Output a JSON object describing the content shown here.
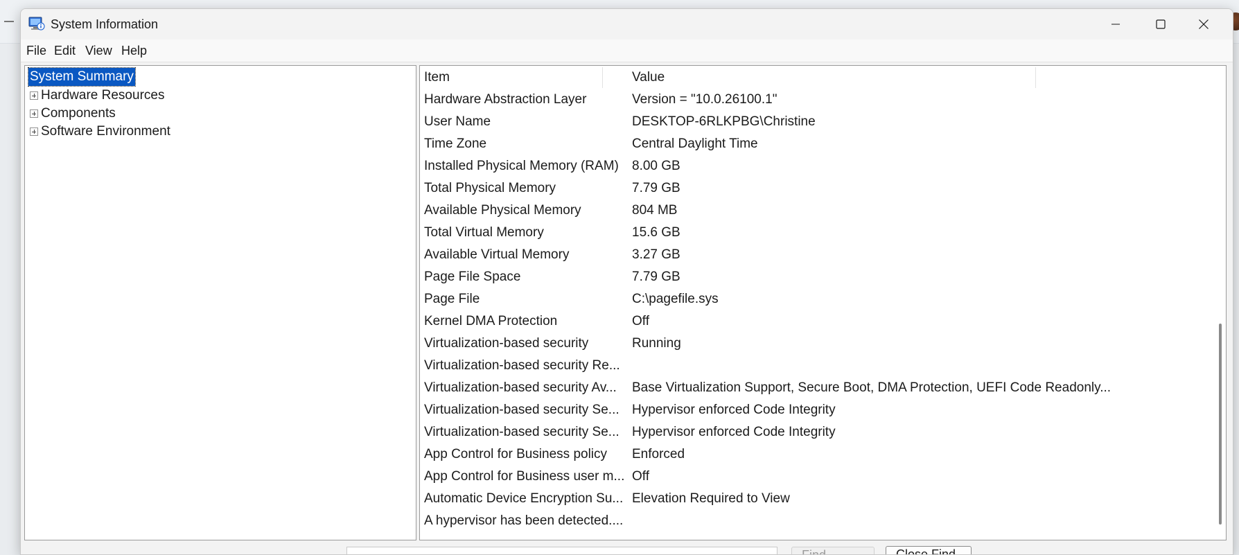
{
  "window": {
    "title": "System Information"
  },
  "menu": [
    "File",
    "Edit",
    "View",
    "Help"
  ],
  "tree": {
    "selected": "System Summary",
    "children": [
      "Hardware Resources",
      "Components",
      "Software Environment"
    ]
  },
  "list": {
    "columns": [
      "Item",
      "Value"
    ],
    "rows": [
      {
        "item": "Hardware Abstraction Layer",
        "value": "Version = \"10.0.26100.1\""
      },
      {
        "item": "User Name",
        "value": "DESKTOP-6RLKPBG\\Christine"
      },
      {
        "item": "Time Zone",
        "value": "Central Daylight Time"
      },
      {
        "item": "Installed Physical Memory (RAM)",
        "value": "8.00 GB"
      },
      {
        "item": "Total Physical Memory",
        "value": "7.79 GB"
      },
      {
        "item": "Available Physical Memory",
        "value": "804 MB"
      },
      {
        "item": "Total Virtual Memory",
        "value": "15.6 GB"
      },
      {
        "item": "Available Virtual Memory",
        "value": "3.27 GB"
      },
      {
        "item": "Page File Space",
        "value": "7.79 GB"
      },
      {
        "item": "Page File",
        "value": "C:\\pagefile.sys"
      },
      {
        "item": "Kernel DMA Protection",
        "value": "Off"
      },
      {
        "item": "Virtualization-based security",
        "value": "Running"
      },
      {
        "item": "Virtualization-based security Re...",
        "value": ""
      },
      {
        "item": "Virtualization-based security Av...",
        "value": "Base Virtualization Support, Secure Boot, DMA Protection, UEFI Code Readonly..."
      },
      {
        "item": "Virtualization-based security Se...",
        "value": "Hypervisor enforced Code Integrity"
      },
      {
        "item": "Virtualization-based security Se...",
        "value": "Hypervisor enforced Code Integrity"
      },
      {
        "item": "App Control for Business policy",
        "value": "Enforced"
      },
      {
        "item": "App Control for Business user m...",
        "value": "Off"
      },
      {
        "item": "Automatic Device Encryption Su...",
        "value": "Elevation Required to View"
      },
      {
        "item": "A hypervisor has been detected....",
        "value": ""
      }
    ]
  },
  "find": {
    "find_label": "Find",
    "close_find_label": "Close Find"
  },
  "icons": {
    "app": "system-information-icon",
    "minimize": "minimize-icon",
    "maximize": "maximize-icon",
    "close": "close-icon",
    "expand": "plus-box-icon"
  },
  "colors": {
    "selection": "#0a58c2",
    "window_bg": "#f3f3f3"
  }
}
